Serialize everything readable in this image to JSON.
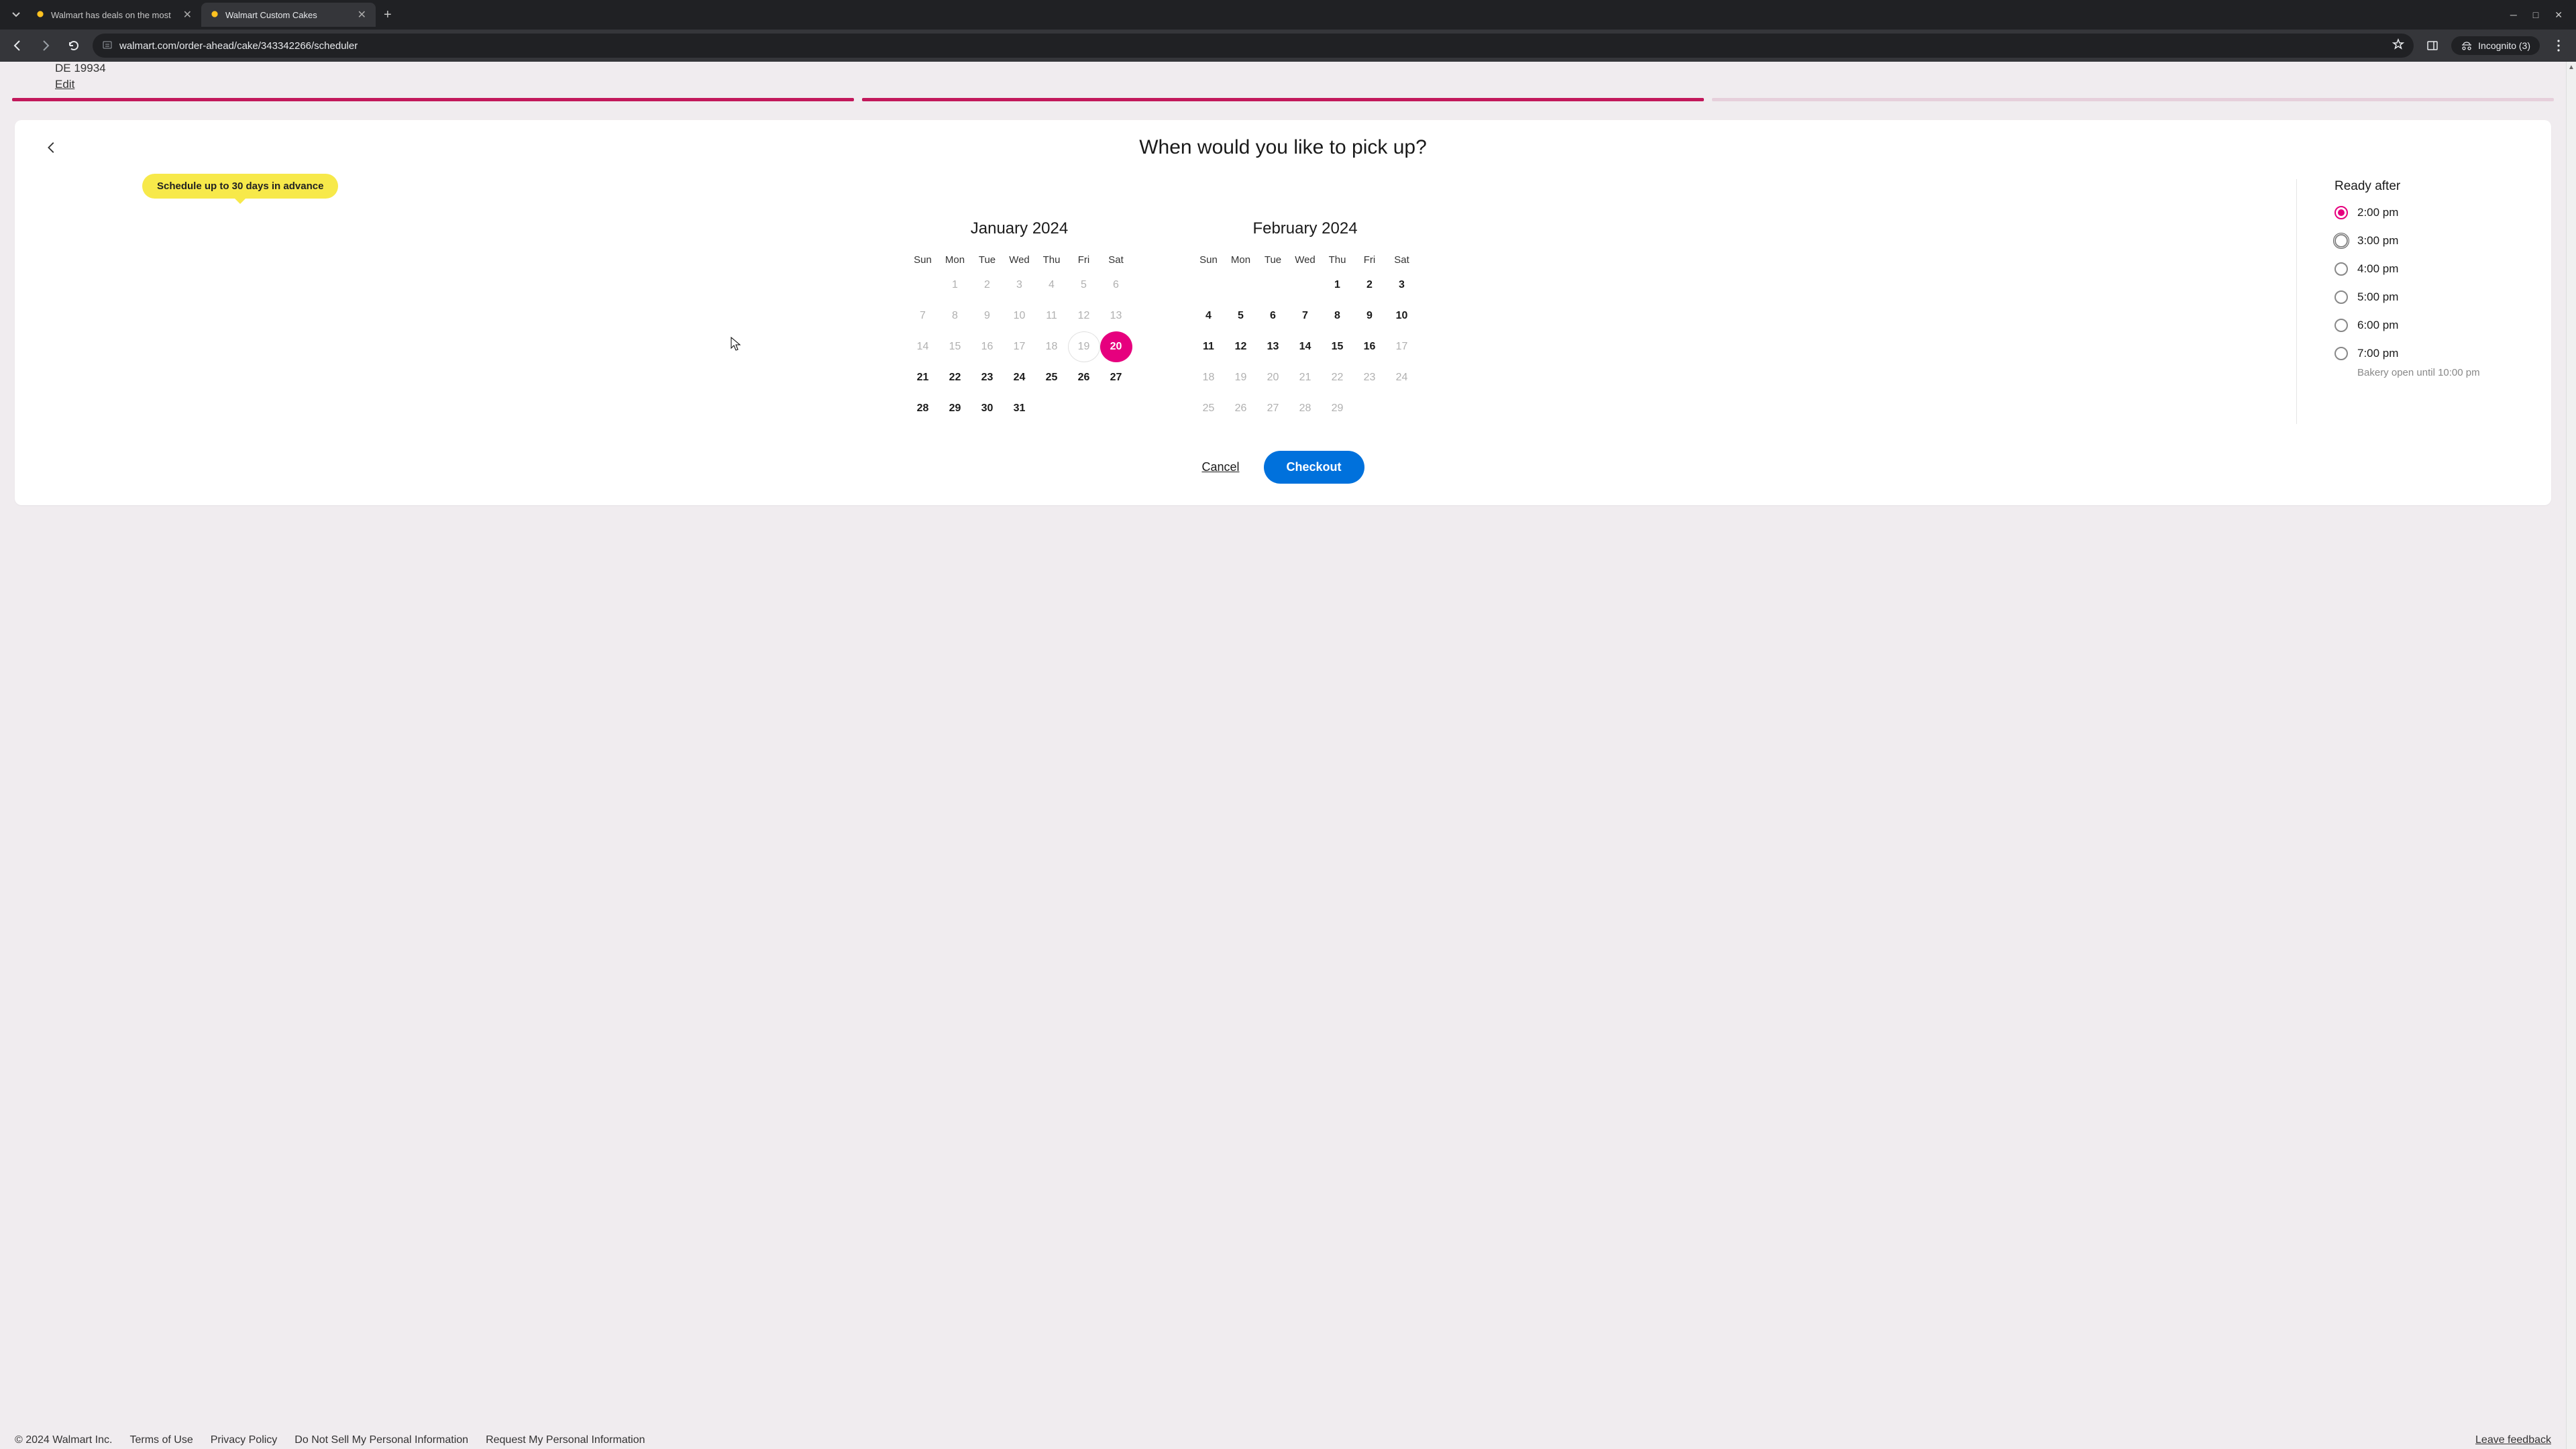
{
  "browser": {
    "tabs": [
      {
        "title": "Walmart has deals on the most",
        "active": false
      },
      {
        "title": "Walmart Custom Cakes",
        "active": true
      }
    ],
    "url": "walmart.com/order-ahead/cake/343342266/scheduler",
    "incognito_label": "Incognito (3)"
  },
  "address": {
    "line": "DE 19934",
    "edit": "Edit"
  },
  "scheduler": {
    "heading": "When would you like to pick up?",
    "badge": "Schedule up to 30 days in advance",
    "day_names": [
      "Sun",
      "Mon",
      "Tue",
      "Wed",
      "Thu",
      "Fri",
      "Sat"
    ],
    "months": [
      {
        "title": "January 2024",
        "weeks": [
          [
            null,
            {
              "n": 1,
              "s": "d"
            },
            {
              "n": 2,
              "s": "d"
            },
            {
              "n": 3,
              "s": "d"
            },
            {
              "n": 4,
              "s": "d"
            },
            {
              "n": 5,
              "s": "d"
            },
            {
              "n": 6,
              "s": "d"
            }
          ],
          [
            {
              "n": 7,
              "s": "d"
            },
            {
              "n": 8,
              "s": "d"
            },
            {
              "n": 9,
              "s": "d"
            },
            {
              "n": 10,
              "s": "d"
            },
            {
              "n": 11,
              "s": "d"
            },
            {
              "n": 12,
              "s": "d"
            },
            {
              "n": 13,
              "s": "d"
            }
          ],
          [
            {
              "n": 14,
              "s": "d"
            },
            {
              "n": 15,
              "s": "d"
            },
            {
              "n": 16,
              "s": "d"
            },
            {
              "n": 17,
              "s": "d"
            },
            {
              "n": 18,
              "s": "d"
            },
            {
              "n": 19,
              "s": "h"
            },
            {
              "n": 20,
              "s": "sel"
            }
          ],
          [
            {
              "n": 21,
              "s": "a"
            },
            {
              "n": 22,
              "s": "a"
            },
            {
              "n": 23,
              "s": "a"
            },
            {
              "n": 24,
              "s": "a"
            },
            {
              "n": 25,
              "s": "a"
            },
            {
              "n": 26,
              "s": "a"
            },
            {
              "n": 27,
              "s": "a"
            }
          ],
          [
            {
              "n": 28,
              "s": "a"
            },
            {
              "n": 29,
              "s": "a"
            },
            {
              "n": 30,
              "s": "a"
            },
            {
              "n": 31,
              "s": "a"
            },
            null,
            null,
            null
          ]
        ]
      },
      {
        "title": "February 2024",
        "weeks": [
          [
            null,
            null,
            null,
            null,
            {
              "n": 1,
              "s": "a"
            },
            {
              "n": 2,
              "s": "a"
            },
            {
              "n": 3,
              "s": "a"
            }
          ],
          [
            {
              "n": 4,
              "s": "a"
            },
            {
              "n": 5,
              "s": "a"
            },
            {
              "n": 6,
              "s": "a"
            },
            {
              "n": 7,
              "s": "a"
            },
            {
              "n": 8,
              "s": "a"
            },
            {
              "n": 9,
              "s": "a"
            },
            {
              "n": 10,
              "s": "a"
            }
          ],
          [
            {
              "n": 11,
              "s": "a"
            },
            {
              "n": 12,
              "s": "a"
            },
            {
              "n": 13,
              "s": "a"
            },
            {
              "n": 14,
              "s": "a"
            },
            {
              "n": 15,
              "s": "a"
            },
            {
              "n": 16,
              "s": "a"
            },
            {
              "n": 17,
              "s": "d"
            }
          ],
          [
            {
              "n": 18,
              "s": "d"
            },
            {
              "n": 19,
              "s": "d"
            },
            {
              "n": 20,
              "s": "d"
            },
            {
              "n": 21,
              "s": "d"
            },
            {
              "n": 22,
              "s": "d"
            },
            {
              "n": 23,
              "s": "d"
            },
            {
              "n": 24,
              "s": "d"
            }
          ],
          [
            {
              "n": 25,
              "s": "d"
            },
            {
              "n": 26,
              "s": "d"
            },
            {
              "n": 27,
              "s": "d"
            },
            {
              "n": 28,
              "s": "d"
            },
            {
              "n": 29,
              "s": "d"
            },
            null,
            null
          ]
        ]
      }
    ],
    "times": {
      "title": "Ready after",
      "options": [
        {
          "label": "2:00 pm",
          "selected": true,
          "focus": false
        },
        {
          "label": "3:00 pm",
          "selected": false,
          "focus": true
        },
        {
          "label": "4:00 pm",
          "selected": false,
          "focus": false
        },
        {
          "label": "5:00 pm",
          "selected": false,
          "focus": false
        },
        {
          "label": "6:00 pm",
          "selected": false,
          "focus": false
        },
        {
          "label": "7:00 pm",
          "selected": false,
          "focus": false
        }
      ],
      "note": "Bakery open until 10:00 pm"
    },
    "actions": {
      "cancel": "Cancel",
      "checkout": "Checkout"
    }
  },
  "footer": {
    "copyright": "© 2024 Walmart Inc.",
    "links": [
      "Terms of Use",
      "Privacy Policy",
      "Do Not Sell My Personal Information",
      "Request My Personal Information"
    ],
    "feedback": "Leave feedback"
  }
}
